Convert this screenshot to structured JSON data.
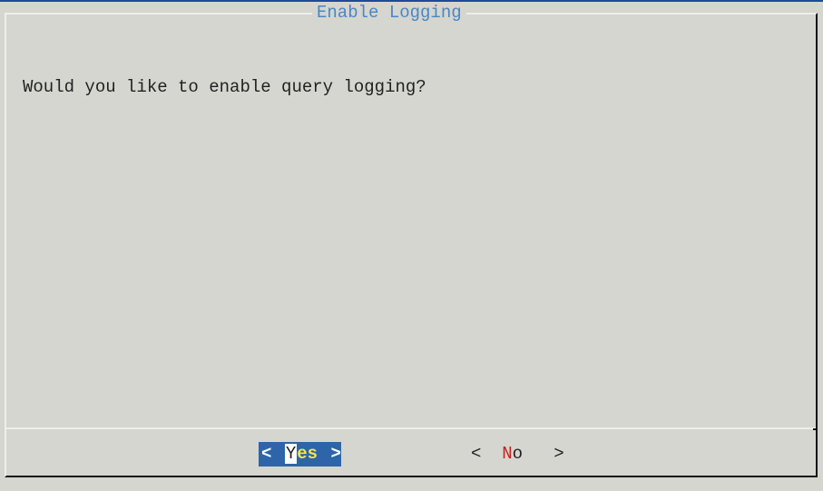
{
  "dialog": {
    "title": "Enable Logging",
    "question": "Would you like to enable query logging?"
  },
  "buttons": {
    "yes": {
      "left": "<",
      "hotkey": "Y",
      "rest": "es",
      "right": ">",
      "selected": true
    },
    "no": {
      "left": "<",
      "hotkey": "N",
      "rest": "o",
      "right": ">",
      "selected": false
    }
  },
  "colors": {
    "background": "#d4d6cf",
    "title": "#4a86c8",
    "selected_button_bg": "#2d65a8",
    "selected_button_text": "#f3e64a",
    "hotkey_red": "#c81e1e"
  }
}
